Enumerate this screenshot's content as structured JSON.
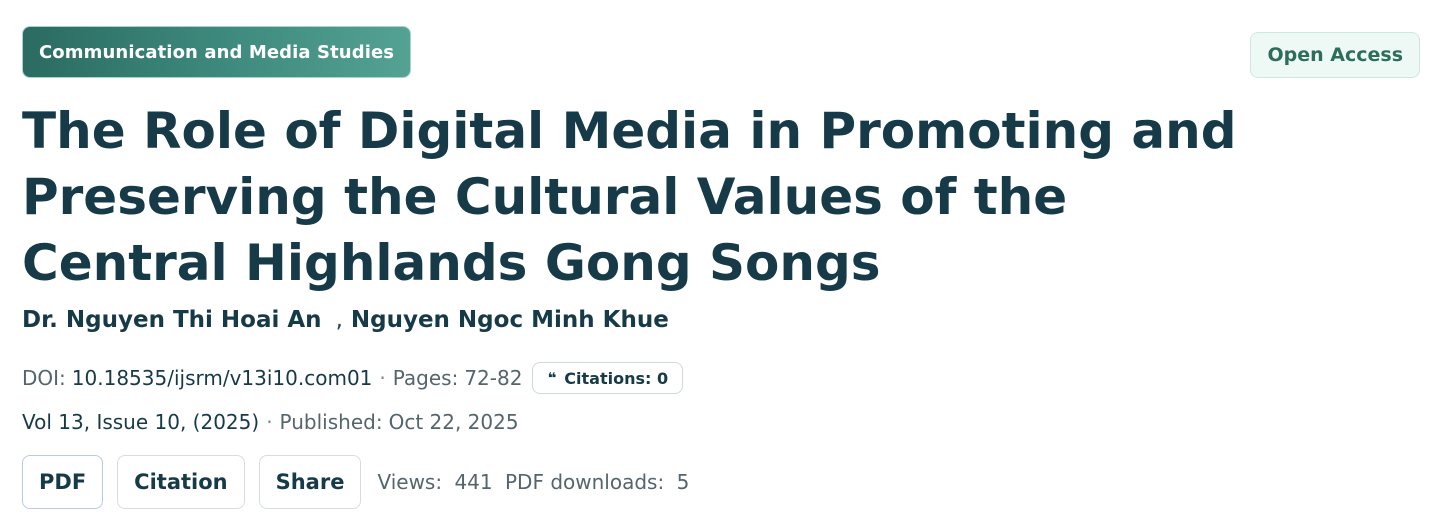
{
  "category": {
    "label": "Communication and Media Studies"
  },
  "access": {
    "label": "Open Access"
  },
  "article": {
    "title": "The Role of Digital Media in Promoting and Preserving the Cultural Values of the Central Highlands Gong Songs"
  },
  "authors": {
    "list": [
      "Dr. Nguyen Thi Hoai An",
      "Nguyen Ngoc Minh Khue"
    ],
    "separator": ","
  },
  "meta": {
    "doi_label": "DOI:",
    "doi_value": "10.18535/ijsrm/v13i10.com01",
    "dot": "·",
    "pages_label": "Pages:",
    "pages_value": "72-82",
    "citations_label": "Citations: 0",
    "volume": "Vol 13, Issue 10, (2025)",
    "published_label": "Published:",
    "published_value": "Oct 22, 2025"
  },
  "icons": {
    "quote": "quote-icon"
  },
  "actions": {
    "pdf": "PDF",
    "citation": "Citation",
    "share": "Share"
  },
  "stats": {
    "views_label": "Views:",
    "views_value": "441",
    "downloads_label": "PDF downloads:",
    "downloads_value": "5"
  },
  "colors": {
    "title": "#173a48",
    "category_start": "#2b6b61",
    "category_end": "#54a293",
    "open_access_bg": "#eef8f4",
    "open_access_text": "#2c6e5b",
    "meta_text": "#55656d",
    "pdf_button_border": "#b9c9ee"
  }
}
